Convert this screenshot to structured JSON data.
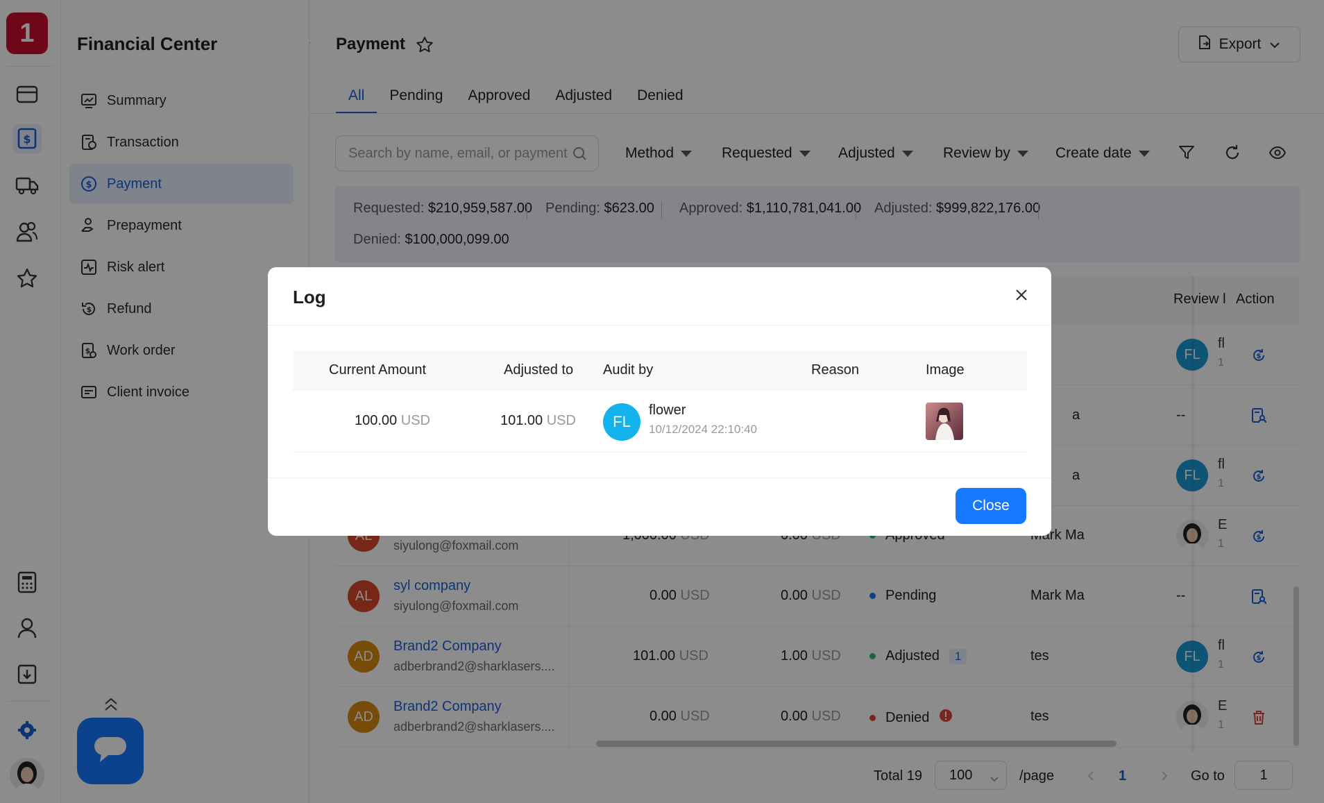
{
  "app": {
    "logo_text": "1",
    "section_title": "Financial Center",
    "brand_color": "#c8102e",
    "accent_color": "#1677ff"
  },
  "rail": {
    "icons": [
      "card-icon",
      "dollar-doc-icon",
      "truck-icon",
      "users-icon",
      "star-icon",
      "calculator-icon",
      "person-icon",
      "download-icon",
      "settings-icon",
      "user-avatar"
    ]
  },
  "sidebar": {
    "items": [
      {
        "label": "Summary",
        "icon": "chart-icon"
      },
      {
        "label": "Transaction",
        "icon": "transaction-icon"
      },
      {
        "label": "Payment",
        "icon": "payment-icon",
        "active": true
      },
      {
        "label": "Prepayment",
        "icon": "hand-coin-icon"
      },
      {
        "label": "Risk alert",
        "icon": "pulse-icon"
      },
      {
        "label": "Refund",
        "icon": "refund-icon"
      },
      {
        "label": "Work order",
        "icon": "work-order-icon"
      },
      {
        "label": "Client invoice",
        "icon": "invoice-icon"
      }
    ]
  },
  "header": {
    "title": "Payment",
    "export_label": "Export"
  },
  "tabs": [
    {
      "label": "All",
      "active": true
    },
    {
      "label": "Pending"
    },
    {
      "label": "Approved"
    },
    {
      "label": "Adjusted"
    },
    {
      "label": "Denied"
    }
  ],
  "filters": {
    "search_placeholder": "Search by name, email, or payment",
    "method": "Method",
    "requested": "Requested",
    "adjusted": "Adjusted",
    "review_by": "Review by",
    "create_date": "Create date"
  },
  "summary": {
    "requested_label": "Requested:",
    "requested_value": "$210,959,587.00",
    "pending_label": "Pending:",
    "pending_value": "$623.00",
    "approved_label": "Approved:",
    "approved_value": "$1,110,781,041.00",
    "adjusted_label": "Adjusted:",
    "adjusted_value": "$999,822,176.00",
    "denied_label": "Denied:",
    "denied_value": "$100,000,099.00"
  },
  "table": {
    "columns": {
      "review": "Review l",
      "action": "Action"
    },
    "rows": [
      {
        "reviewer_initials": "FL",
        "reviewer_name": "fl",
        "reviewer_sub": "1",
        "action_icon": "sync-dollar-icon"
      },
      {
        "note": "a",
        "reviewer_dash": "--",
        "action_icon": "doc-user-icon"
      },
      {
        "note": "a",
        "reviewer_initials": "FL",
        "reviewer_name": "fl",
        "reviewer_sub": "1",
        "action_icon": "sync-dollar-icon"
      },
      {
        "initials": "AL",
        "email": "siyulong@foxmail.com",
        "requested": "1,000.00",
        "adjusted": "0.00",
        "currency": "USD",
        "status": "Approved",
        "review": "Mark Ma",
        "reviewer_name": "E",
        "reviewer_sub": "1",
        "action_icon": "sync-dollar-icon"
      },
      {
        "initials": "AL",
        "company": "syl company",
        "email": "siyulong@foxmail.com",
        "requested": "0.00",
        "adjusted": "0.00",
        "currency": "USD",
        "status": "Pending",
        "review": "Mark Ma",
        "reviewer_dash": "--",
        "action_icon": "doc-user-icon"
      },
      {
        "initials": "AD",
        "company": "Brand2 Company",
        "email": "adberbrand2@sharklasers....",
        "requested": "101.00",
        "adjusted": "1.00",
        "currency": "USD",
        "status": "Adjusted",
        "status_count": "1",
        "review": "tes",
        "reviewer_initials": "FL",
        "reviewer_name": "fl",
        "reviewer_sub": "1",
        "action_icon": "sync-dollar-icon"
      },
      {
        "initials": "AD",
        "company": "Brand2 Company",
        "email": "adberbrand2@sharklasers....",
        "requested": "0.00",
        "adjusted": "0.00",
        "currency": "USD",
        "status": "Denied",
        "review": "tes",
        "reviewer_name": "E",
        "reviewer_sub": "1",
        "action_icon": "trash-icon"
      }
    ]
  },
  "pagination": {
    "total": "Total 19",
    "page_size": "100",
    "per_page": "/page",
    "current": "1",
    "goto_label": "Go to",
    "goto_value": "1"
  },
  "modal": {
    "title": "Log",
    "columns": {
      "current": "Current Amount",
      "adjusted": "Adjusted to",
      "audit": "Audit by",
      "reason": "Reason",
      "image": "Image"
    },
    "row": {
      "current_amount": "100.00",
      "adjusted_to": "101.00",
      "currency": "USD",
      "auditor_initials": "FL",
      "auditor_name": "flower",
      "audit_time": "10/12/2024 22:10:40",
      "reason": ""
    },
    "close_label": "Close"
  }
}
